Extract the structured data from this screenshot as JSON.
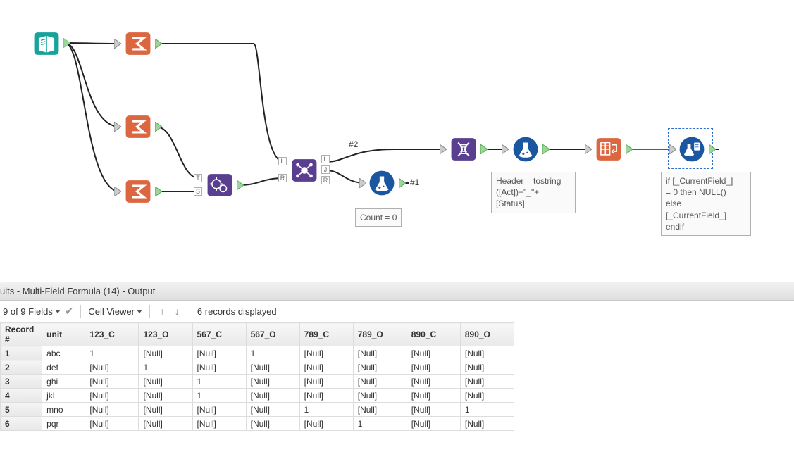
{
  "canvas": {
    "labels": {
      "branch1": "#2",
      "branch2": "#1"
    },
    "annotations": {
      "count": "Count = 0",
      "header": "Header = tostring\n([Act])+\"_\"+\n[Status]",
      "formula_if": "if [_CurrentField_]\n= 0 then NULL()\nelse\n[_CurrentField_]\nendif"
    },
    "port_labels": {
      "appendT": "T",
      "appendS": "S",
      "joinL1": "L",
      "joinR1": "R",
      "joinL2": "L",
      "joinJ2": "J",
      "joinR2": "R"
    }
  },
  "results": {
    "title": "ults - Multi-Field Formula (14) - Output",
    "toolbar": {
      "fields": "9 of 9 Fields",
      "cellviewer": "Cell Viewer",
      "message": "6 records displayed"
    },
    "columns": [
      "Record #",
      "unit",
      "123_C",
      "123_O",
      "567_C",
      "567_O",
      "789_C",
      "789_O",
      "890_C",
      "890_O"
    ],
    "rows": [
      {
        "n": "1",
        "unit": "abc",
        "v": [
          "1",
          "[Null]",
          "[Null]",
          "1",
          "[Null]",
          "[Null]",
          "[Null]",
          "[Null]"
        ]
      },
      {
        "n": "2",
        "unit": "def",
        "v": [
          "[Null]",
          "1",
          "[Null]",
          "[Null]",
          "[Null]",
          "[Null]",
          "[Null]",
          "[Null]"
        ]
      },
      {
        "n": "3",
        "unit": "ghi",
        "v": [
          "[Null]",
          "[Null]",
          "1",
          "[Null]",
          "[Null]",
          "[Null]",
          "[Null]",
          "[Null]"
        ]
      },
      {
        "n": "4",
        "unit": "jkl",
        "v": [
          "[Null]",
          "[Null]",
          "1",
          "[Null]",
          "[Null]",
          "[Null]",
          "[Null]",
          "[Null]"
        ]
      },
      {
        "n": "5",
        "unit": "mno",
        "v": [
          "[Null]",
          "[Null]",
          "[Null]",
          "[Null]",
          "1",
          "[Null]",
          "[Null]",
          "1"
        ]
      },
      {
        "n": "6",
        "unit": "pqr",
        "v": [
          "[Null]",
          "[Null]",
          "[Null]",
          "[Null]",
          "[Null]",
          "1",
          "[Null]",
          "[Null]"
        ]
      }
    ]
  },
  "colors": {
    "teal": "#17a39a",
    "orange": "#db6640",
    "purple": "#5a3e8f",
    "blue": "#1b56a0",
    "white": "#ffffff"
  }
}
